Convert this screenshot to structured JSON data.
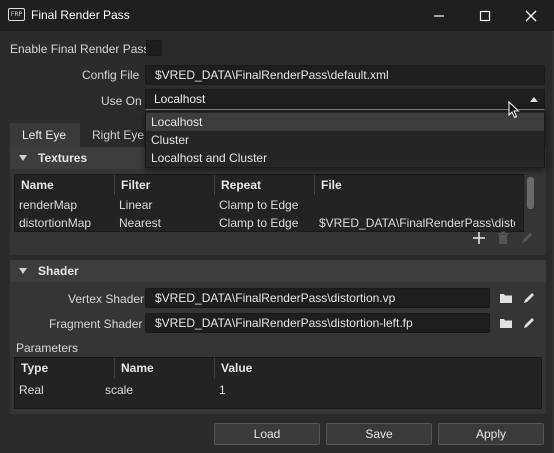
{
  "window": {
    "icon_text": "FRP",
    "title": "Final Render Pass"
  },
  "general": {
    "enable_label": "Enable Final Render Pass",
    "config_label": "Config File",
    "config_value": "$VRED_DATA\\FinalRenderPass\\default.xml",
    "use_on_label": "Use On",
    "use_on_value": "Localhost",
    "use_on_options": [
      "Localhost",
      "Cluster",
      "Localhost and Cluster"
    ]
  },
  "tabs": [
    "Left Eye",
    "Right Eye"
  ],
  "textures": {
    "title": "Textures",
    "columns": [
      "Name",
      "Filter",
      "Repeat",
      "File"
    ],
    "rows": [
      [
        "renderMap",
        "Linear",
        "Clamp to Edge",
        ""
      ],
      [
        "distortionMap",
        "Nearest",
        "Clamp to Edge",
        "$VRED_DATA\\FinalRenderPass\\distor..."
      ]
    ]
  },
  "shader": {
    "title": "Shader",
    "vertex_label": "Vertex Shader",
    "vertex_value": "$VRED_DATA\\FinalRenderPass\\distortion.vp",
    "fragment_label": "Fragment Shader",
    "fragment_value": "$VRED_DATA\\FinalRenderPass\\distortion-left.fp",
    "params_label": "Parameters",
    "param_columns": [
      "Type",
      "Name",
      "Value"
    ],
    "param_rows": [
      [
        "Real",
        "scale",
        "1"
      ]
    ]
  },
  "buttons": {
    "load": "Load",
    "save": "Save",
    "apply": "Apply"
  },
  "icons": [
    "app-icon",
    "minimize-icon",
    "maximize-icon",
    "close-icon",
    "add-icon",
    "delete-icon",
    "edit-icon",
    "folder-icon",
    "chevron-down-icon"
  ],
  "colors": {
    "accent": "#4a8bd6",
    "background": "#2b2b2b",
    "titlebar": "#1f1f1f"
  }
}
